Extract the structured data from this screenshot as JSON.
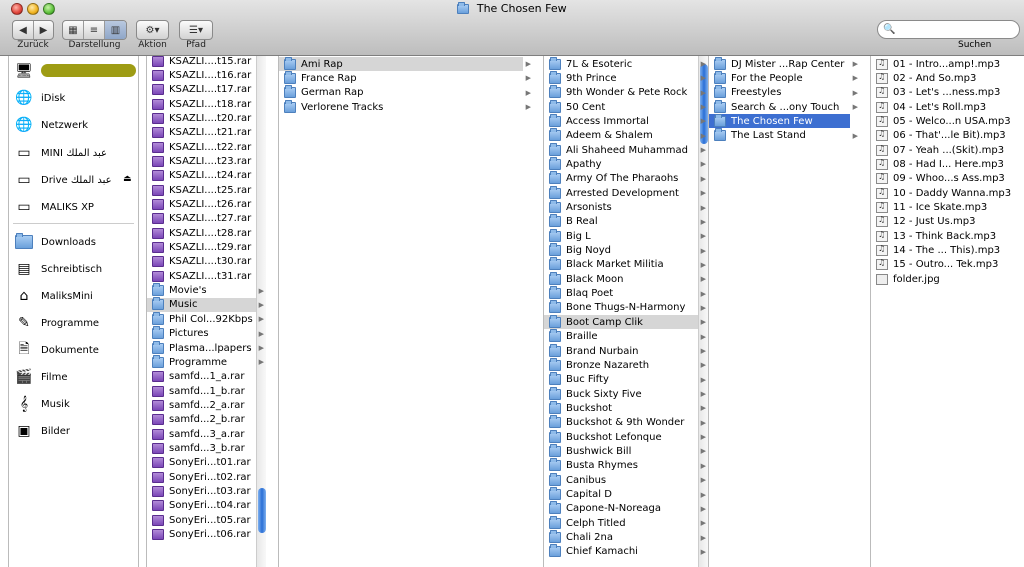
{
  "window": {
    "title": "The Chosen Few"
  },
  "toolbar": {
    "back_label": "Zurück",
    "view_label": "Darstellung",
    "action_label": "Aktion",
    "path_label": "Pfad",
    "search_label": "Suchen",
    "search_placeholder": ""
  },
  "sidebar": {
    "items": [
      {
        "label": "",
        "icon": "computer-icon"
      },
      {
        "label": "iDisk",
        "icon": "globe-icon"
      },
      {
        "label": "Netzwerk",
        "icon": "globe-icon"
      },
      {
        "label": "MINI عبد الملك",
        "icon": "drive-icon"
      },
      {
        "label": "Drive عبد الملك",
        "icon": "drive-icon"
      },
      {
        "label": "MALIKS XP",
        "icon": "drive-icon"
      },
      {
        "label": "Downloads",
        "icon": "folder-icon"
      },
      {
        "label": "Schreibtisch",
        "icon": "desktop-icon"
      },
      {
        "label": "MaliksMini",
        "icon": "home-icon"
      },
      {
        "label": "Programme",
        "icon": "apps-icon"
      },
      {
        "label": "Dokumente",
        "icon": "document-icon"
      },
      {
        "label": "Filme",
        "icon": "film-icon"
      },
      {
        "label": "Musik",
        "icon": "music-icon"
      },
      {
        "label": "Bilder",
        "icon": "pictures-icon"
      }
    ]
  },
  "col1": {
    "items": [
      {
        "label": "KSAZLI....t15.rar",
        "type": "rar"
      },
      {
        "label": "KSAZLI....t16.rar",
        "type": "rar"
      },
      {
        "label": "KSAZLI....t17.rar",
        "type": "rar"
      },
      {
        "label": "KSAZLI....t18.rar",
        "type": "rar"
      },
      {
        "label": "KSAZLI....t20.rar",
        "type": "rar"
      },
      {
        "label": "KSAZLI....t21.rar",
        "type": "rar"
      },
      {
        "label": "KSAZLI....t22.rar",
        "type": "rar"
      },
      {
        "label": "KSAZLI....t23.rar",
        "type": "rar"
      },
      {
        "label": "KSAZLI....t24.rar",
        "type": "rar"
      },
      {
        "label": "KSAZLI....t25.rar",
        "type": "rar"
      },
      {
        "label": "KSAZLI....t26.rar",
        "type": "rar"
      },
      {
        "label": "KSAZLI....t27.rar",
        "type": "rar"
      },
      {
        "label": "KSAZLI....t28.rar",
        "type": "rar"
      },
      {
        "label": "KSAZLI....t29.rar",
        "type": "rar"
      },
      {
        "label": "KSAZLI....t30.rar",
        "type": "rar"
      },
      {
        "label": "KSAZLI....t31.rar",
        "type": "rar"
      },
      {
        "label": "Movie's",
        "type": "folder",
        "arrow": true
      },
      {
        "label": "Music",
        "type": "folder",
        "arrow": true,
        "selected": "gray"
      },
      {
        "label": "Phil Col...92Kbps",
        "type": "folder",
        "arrow": true
      },
      {
        "label": "Pictures",
        "type": "folder",
        "arrow": true
      },
      {
        "label": "Plasma...lpapers",
        "type": "folder",
        "arrow": true
      },
      {
        "label": "Programme",
        "type": "folder",
        "arrow": true
      },
      {
        "label": "samfd...1_a.rar",
        "type": "rar"
      },
      {
        "label": "samfd...1_b.rar",
        "type": "rar"
      },
      {
        "label": "samfd...2_a.rar",
        "type": "rar"
      },
      {
        "label": "samfd...2_b.rar",
        "type": "rar"
      },
      {
        "label": "samfd...3_a.rar",
        "type": "rar"
      },
      {
        "label": "samfd...3_b.rar",
        "type": "rar"
      },
      {
        "label": "SonyEri...t01.rar",
        "type": "rar"
      },
      {
        "label": "SonyEri...t02.rar",
        "type": "rar"
      },
      {
        "label": "SonyEri...t03.rar",
        "type": "rar"
      },
      {
        "label": "SonyEri...t04.rar",
        "type": "rar"
      },
      {
        "label": "SonyEri...t05.rar",
        "type": "rar"
      },
      {
        "label": "SonyEri...t06.rar",
        "type": "rar"
      }
    ]
  },
  "col2": {
    "items": [
      {
        "label": "Ami Rap",
        "type": "folder",
        "arrow": true,
        "selected": "gray"
      },
      {
        "label": "France Rap",
        "type": "folder",
        "arrow": true
      },
      {
        "label": "German Rap",
        "type": "folder",
        "arrow": true
      },
      {
        "label": "Verlorene Tracks",
        "type": "folder",
        "arrow": true
      }
    ]
  },
  "col3": {
    "items": [
      {
        "label": "7L & Esoteric",
        "type": "folder",
        "arrow": true
      },
      {
        "label": "9th Prince",
        "type": "folder",
        "arrow": true
      },
      {
        "label": "9th Wonder & Pete Rock",
        "type": "folder",
        "arrow": true
      },
      {
        "label": "50 Cent",
        "type": "folder",
        "arrow": true
      },
      {
        "label": "Access Immortal",
        "type": "folder",
        "arrow": true
      },
      {
        "label": "Adeem & Shalem",
        "type": "folder",
        "arrow": true
      },
      {
        "label": "Ali Shaheed Muhammad",
        "type": "folder",
        "arrow": true
      },
      {
        "label": "Apathy",
        "type": "folder",
        "arrow": true
      },
      {
        "label": "Army Of The Pharaohs",
        "type": "folder",
        "arrow": true
      },
      {
        "label": "Arrested Development",
        "type": "folder",
        "arrow": true
      },
      {
        "label": "Arsonists",
        "type": "folder",
        "arrow": true
      },
      {
        "label": "B Real",
        "type": "folder",
        "arrow": true
      },
      {
        "label": "Big L",
        "type": "folder",
        "arrow": true
      },
      {
        "label": "Big Noyd",
        "type": "folder",
        "arrow": true
      },
      {
        "label": "Black Market Militia",
        "type": "folder",
        "arrow": true
      },
      {
        "label": "Black Moon",
        "type": "folder",
        "arrow": true
      },
      {
        "label": "Blaq Poet",
        "type": "folder",
        "arrow": true
      },
      {
        "label": "Bone Thugs-N-Harmony",
        "type": "folder",
        "arrow": true
      },
      {
        "label": "Boot Camp Clik",
        "type": "folder",
        "arrow": true,
        "selected": "gray"
      },
      {
        "label": "Braille",
        "type": "folder",
        "arrow": true
      },
      {
        "label": "Brand Nurbain",
        "type": "folder",
        "arrow": true
      },
      {
        "label": "Bronze Nazareth",
        "type": "folder",
        "arrow": true
      },
      {
        "label": "Buc Fifty",
        "type": "folder",
        "arrow": true
      },
      {
        "label": "Buck Sixty Five",
        "type": "folder",
        "arrow": true
      },
      {
        "label": "Buckshot",
        "type": "folder",
        "arrow": true
      },
      {
        "label": "Buckshot & 9th Wonder",
        "type": "folder",
        "arrow": true
      },
      {
        "label": "Buckshot Lefonque",
        "type": "folder",
        "arrow": true
      },
      {
        "label": "Bushwick Bill",
        "type": "folder",
        "arrow": true
      },
      {
        "label": "Busta Rhymes",
        "type": "folder",
        "arrow": true
      },
      {
        "label": "Canibus",
        "type": "folder",
        "arrow": true
      },
      {
        "label": "Capital D",
        "type": "folder",
        "arrow": true
      },
      {
        "label": "Capone-N-Noreaga",
        "type": "folder",
        "arrow": true
      },
      {
        "label": "Celph Titled",
        "type": "folder",
        "arrow": true
      },
      {
        "label": "Chali 2na",
        "type": "folder",
        "arrow": true
      },
      {
        "label": "Chief Kamachi",
        "type": "folder",
        "arrow": true
      }
    ]
  },
  "col4": {
    "items": [
      {
        "label": "DJ Mister ...Rap Center",
        "type": "folder",
        "arrow": true
      },
      {
        "label": "For the People",
        "type": "folder",
        "arrow": true
      },
      {
        "label": "Freestyles",
        "type": "folder",
        "arrow": true
      },
      {
        "label": "Search & ...ony Touch",
        "type": "folder",
        "arrow": true
      },
      {
        "label": "The Chosen Few",
        "type": "folder",
        "arrow": true,
        "selected": "blue"
      },
      {
        "label": "The Last Stand",
        "type": "folder",
        "arrow": true
      }
    ]
  },
  "col5": {
    "items": [
      {
        "label": "01 - Intro...amp!.mp3",
        "type": "mp3"
      },
      {
        "label": "02 - And So.mp3",
        "type": "mp3"
      },
      {
        "label": "03 - Let's ...ness.mp3",
        "type": "mp3"
      },
      {
        "label": "04 - Let's Roll.mp3",
        "type": "mp3"
      },
      {
        "label": "05 - Welco...n USA.mp3",
        "type": "mp3"
      },
      {
        "label": "06 - That'...le Bit).mp3",
        "type": "mp3"
      },
      {
        "label": "07 - Yeah ...(Skit).mp3",
        "type": "mp3"
      },
      {
        "label": "08 - Had I... Here.mp3",
        "type": "mp3"
      },
      {
        "label": "09 - Whoo...s Ass.mp3",
        "type": "mp3"
      },
      {
        "label": "10 - Daddy Wanna.mp3",
        "type": "mp3"
      },
      {
        "label": "11 - Ice Skate.mp3",
        "type": "mp3"
      },
      {
        "label": "12 - Just Us.mp3",
        "type": "mp3"
      },
      {
        "label": "13 - Think Back.mp3",
        "type": "mp3"
      },
      {
        "label": "14 - The ... This).mp3",
        "type": "mp3"
      },
      {
        "label": "15 - Outro... Tek.mp3",
        "type": "mp3"
      },
      {
        "label": "folder.jpg",
        "type": "jpg"
      }
    ]
  }
}
